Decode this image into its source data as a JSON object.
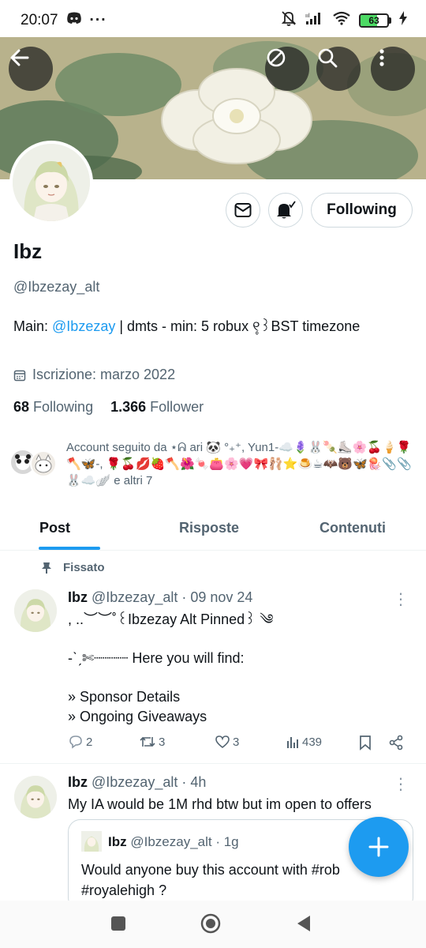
{
  "status_bar": {
    "time": "20:07",
    "dots": "···",
    "battery": "63",
    "battery_level": 0.63
  },
  "banner": {
    "back_icon": "arrow-left-icon",
    "mute_icon": "crossed-circle-icon",
    "search_icon": "search-icon",
    "more_icon": "more-vertical-icon"
  },
  "profile": {
    "name": "Ibz",
    "handle": "@Ibzezay_alt",
    "bio_prefix": "Main: ",
    "bio_link": "@Ibzezay",
    "bio_suffix": " | dmts - min: 5 robux ୧̥꒱BST timezone",
    "joined": "Iscrizione: marzo 2022",
    "following_count": "68",
    "following_label": "Following",
    "follower_count": "1.366",
    "follower_label": "Follower",
    "follow_button": "Following",
    "followed_by": "Account seguito da ⋆ᕱ ari 🐼 °₊⁺, Yun1-☁️🪻🐰🍡⛸️🌸🍒🍦🌹🪓🦋-, 🌹🍒💋🍓🪓🌺🍬👛🌸💗🎀🩰⭐🍮☕🦇🐻🦋🪼📎📎🐰☁️🪽 e altri 7"
  },
  "tabs": [
    {
      "label": "Post"
    },
    {
      "label": "Risposte"
    },
    {
      "label": "Contenuti"
    }
  ],
  "pinned_label": "Fissato",
  "tweets": [
    {
      "name": "Ibz",
      "handle_time": "@Ibzezay_alt · 09 nov 24",
      "body": ", ..︶︶˚꒰Ibzezay Alt Pinned꒱ ༄\n\n-ˋˏ✄┈┈┈┈ Here you will find:\n\n» Sponsor Details\n» Ongoing Giveaways",
      "replies": "2",
      "reposts": "3",
      "likes": "3",
      "views": "439"
    },
    {
      "name": "Ibz",
      "handle_time": "@Ibzezay_alt · 4h",
      "body": "My IA would be 1M rhd btw but im open to offers",
      "quote": {
        "name": "Ibz",
        "handle_time": "@Ibzezay_alt · 1g",
        "body": "Would anyone buy this account with #rob\n#royalehigh ?"
      }
    }
  ],
  "colors": {
    "accent": "#1d9bf0",
    "secondary_text": "#536471",
    "primary_text": "#0f1419"
  }
}
